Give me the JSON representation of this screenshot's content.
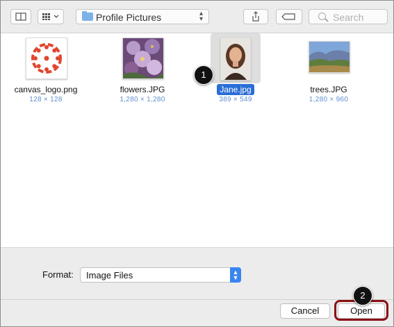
{
  "toolbar": {
    "location": "Profile Pictures",
    "search_placeholder": "Search"
  },
  "files": [
    {
      "name": "canvas_logo.png",
      "size": "128 × 128",
      "selected": false
    },
    {
      "name": "flowers.JPG",
      "size": "1,280 × 1,280",
      "selected": false
    },
    {
      "name": "Jane.jpg",
      "size": "389 × 549",
      "selected": true
    },
    {
      "name": "trees.JPG",
      "size": "1,280 × 960",
      "selected": false
    }
  ],
  "format": {
    "label": "Format:",
    "value": "Image Files"
  },
  "buttons": {
    "cancel": "Cancel",
    "open": "Open"
  },
  "callouts": [
    "1",
    "2"
  ],
  "colors": {
    "selection": "#2a6ed6",
    "callout_ring": "#8b0f14",
    "canvas_red": "#e2452f"
  }
}
